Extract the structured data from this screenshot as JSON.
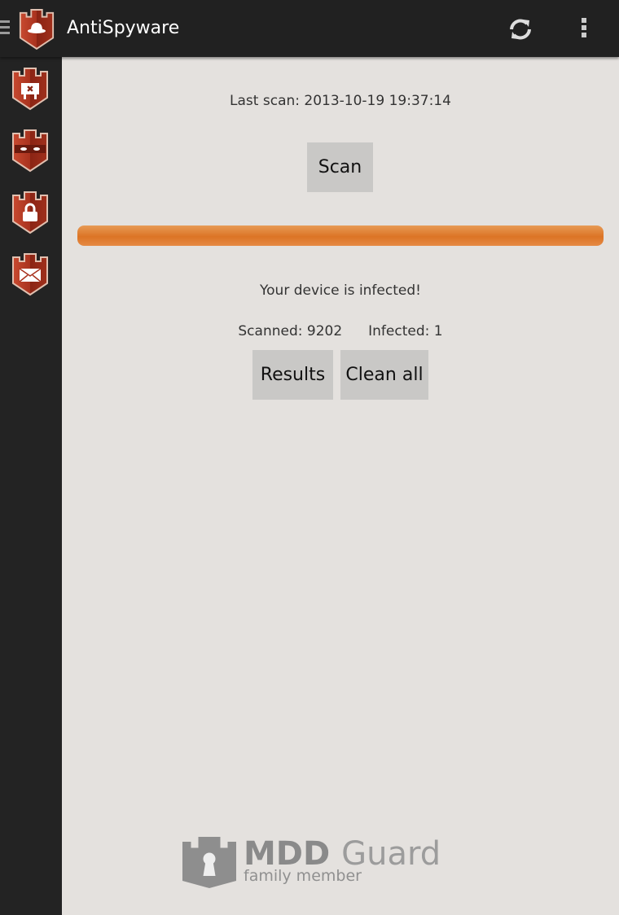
{
  "app": {
    "title": "AntiSpyware"
  },
  "toolbar": {
    "menu_icon": "hamburger-icon",
    "refresh_icon": "refresh-icon",
    "overflow_icon": "more-vert-icon"
  },
  "sidebar": {
    "items": [
      {
        "name": "antispyware",
        "icon": "shield-sign-icon"
      },
      {
        "name": "privacy",
        "icon": "shield-mask-icon"
      },
      {
        "name": "lock",
        "icon": "shield-lock-icon"
      },
      {
        "name": "messages",
        "icon": "shield-envelope-icon"
      }
    ]
  },
  "main": {
    "last_scan": "Last scan: 2013-10-19 19:37:14",
    "scan_label": "Scan",
    "progress_percent": 100,
    "status": "Your device is infected!",
    "scanned": "Scanned: 9202",
    "infected": "Infected: 1",
    "results_label": "Results",
    "clean_label": "Clean all"
  },
  "footer_logo": {
    "brand_a": "MDD",
    "brand_b": "Guard",
    "tagline": "family member"
  },
  "colors": {
    "accent": "#dc7425",
    "shield": "#a8321e",
    "bar_bg": "#212121"
  }
}
